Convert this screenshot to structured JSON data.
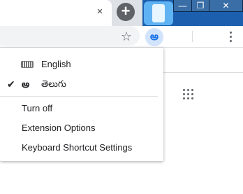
{
  "tabstrip": {
    "close_tab_icon": "×",
    "new_tab_icon": "+"
  },
  "window_controls": {
    "minimize_icon": "—",
    "maximize_icon": "❐",
    "close_icon": "✕"
  },
  "toolbar": {
    "bookmark_icon": "☆",
    "extension_icon": "అ"
  },
  "menu": {
    "languages": [
      {
        "label": "English",
        "icon": "keyboard-icon",
        "selected": false
      },
      {
        "label": "తెలుగు",
        "icon": "telugu-script-icon",
        "icon_glyph": "అ",
        "selected": true
      }
    ],
    "checkmark": "✔",
    "actions": [
      {
        "label": "Turn off"
      },
      {
        "label": "Extension Options"
      },
      {
        "label": "Keyboard Shortcut Settings"
      }
    ]
  },
  "colors": {
    "accent": "#1a73e8",
    "extension_bg": "#d2e3fc",
    "tabstrip_bg": "#dee1e6"
  }
}
